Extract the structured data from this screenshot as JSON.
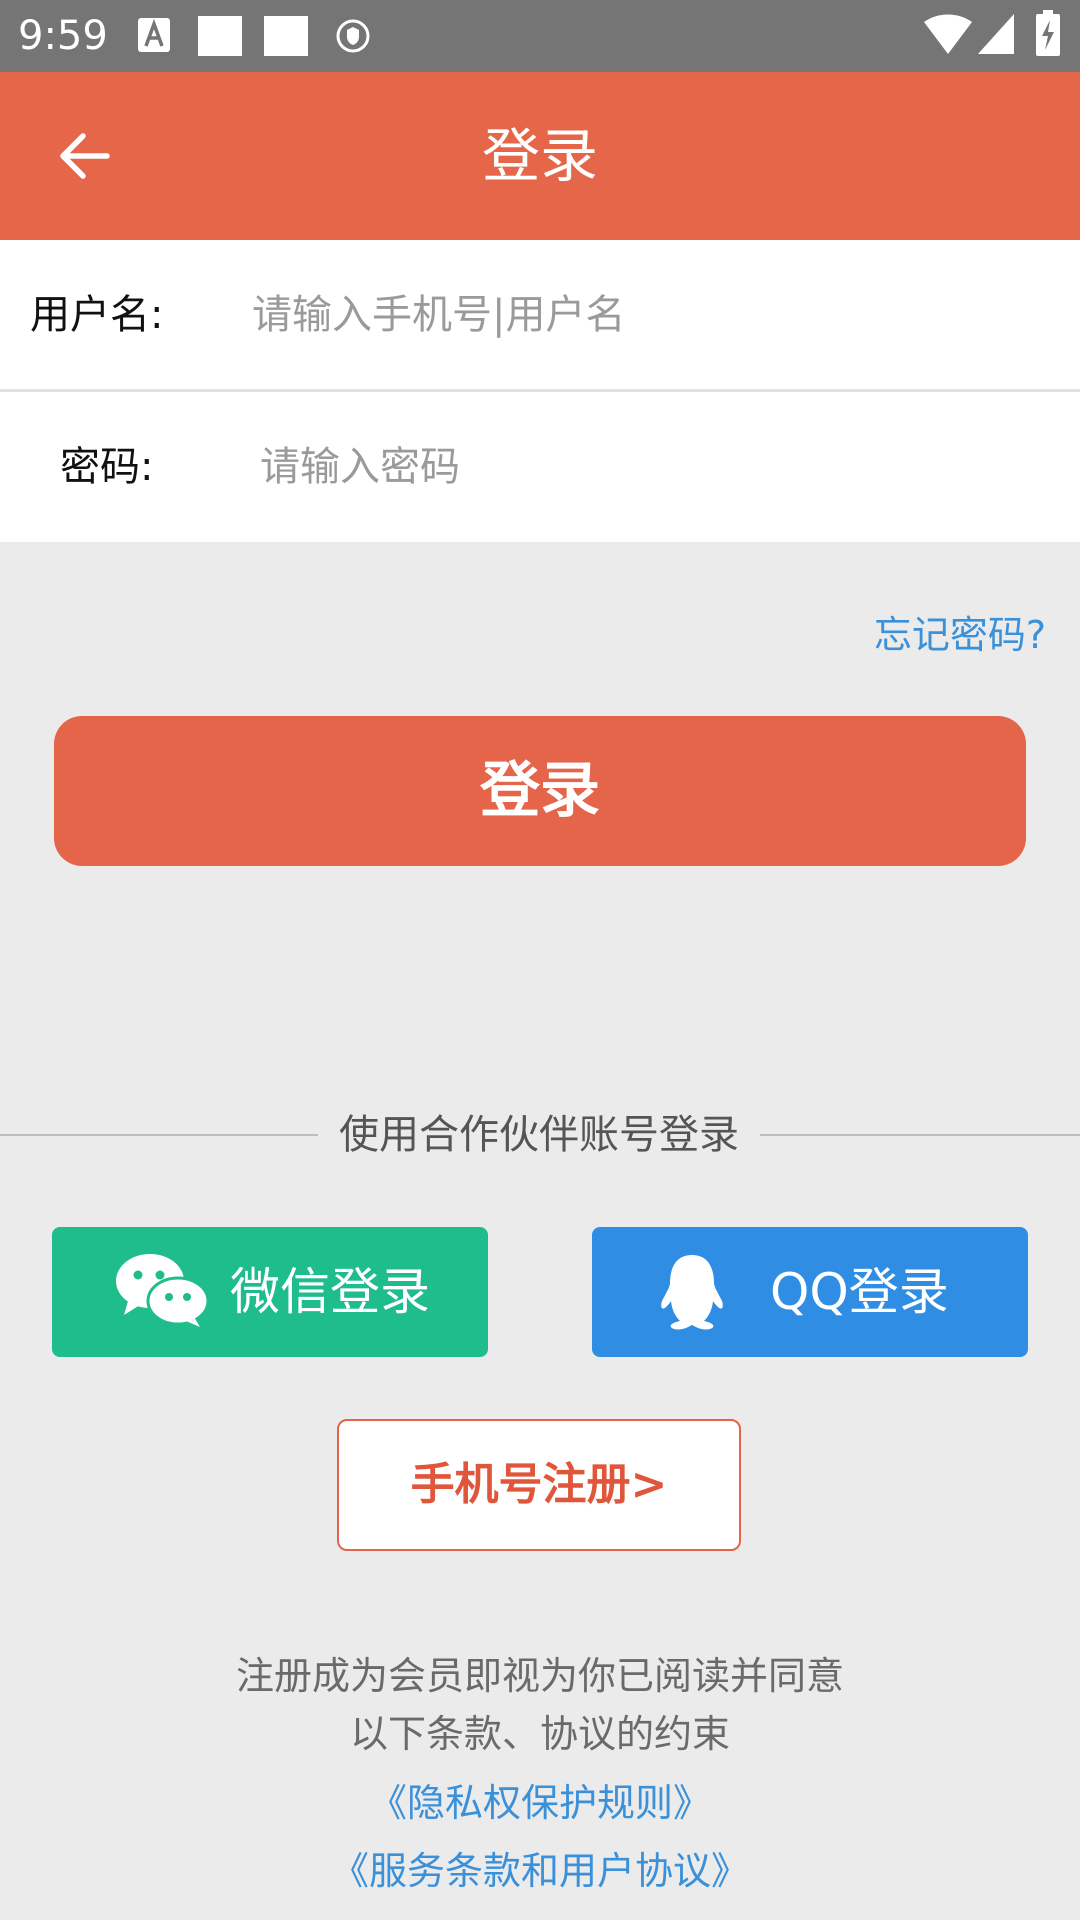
{
  "status_bar": {
    "time": "9:59",
    "icons": [
      "font-a-icon",
      "notification-square-icon",
      "notification-square-icon",
      "shield-icon",
      "wifi-icon",
      "signal-icon",
      "battery-charging-icon"
    ]
  },
  "app_bar": {
    "title": "登录",
    "back_icon": "arrow-left-icon"
  },
  "form": {
    "username_label": "用户名:",
    "username_placeholder": "请输入手机号|用户名",
    "username_value": "",
    "password_label": "密码:",
    "password_placeholder": "请输入密码",
    "password_value": ""
  },
  "forgot_password": "忘记密码?",
  "login_button": "登录",
  "partner": {
    "heading": "使用合作伙伴账号登录",
    "wechat_label": "微信登录",
    "qq_label": "QQ登录"
  },
  "register_button": "手机号注册>",
  "terms": {
    "line1": "注册成为会员即视为你已阅读并同意",
    "line2": "以下条款、协议的约束",
    "privacy_link": "《隐私权保护规则》",
    "service_link": "《服务条款和用户协议》"
  },
  "colors": {
    "accent": "#e56648",
    "wechat": "#20bd8c",
    "qq": "#2f8de4",
    "link": "#3a90d9",
    "background": "#ebebeb"
  }
}
